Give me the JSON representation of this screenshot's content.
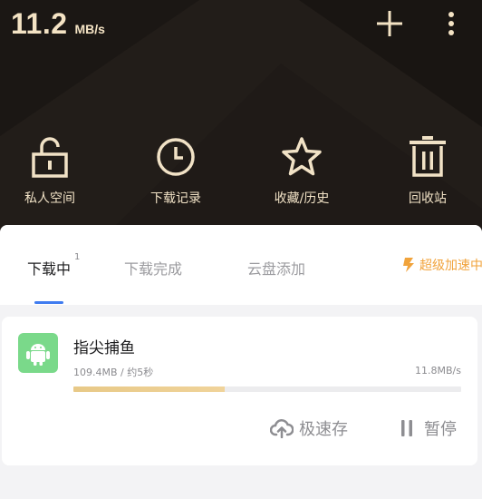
{
  "header": {
    "speed_value": "11.2",
    "speed_unit": "MB/s",
    "add_icon": "plus-icon",
    "more_icon": "more-vertical-icon"
  },
  "quick_actions": [
    {
      "label": "私人空间",
      "icon": "unlock-icon"
    },
    {
      "label": "下载记录",
      "icon": "clock-icon"
    },
    {
      "label": "收藏/历史",
      "icon": "star-icon"
    },
    {
      "label": "回收站",
      "icon": "trash-icon"
    }
  ],
  "tabs": [
    {
      "label": "下载中",
      "badge": "1",
      "active": true
    },
    {
      "label": "下载完成",
      "active": false
    },
    {
      "label": "云盘添加",
      "active": false
    }
  ],
  "boost": {
    "label": "超级加速中",
    "icon": "lightning-icon"
  },
  "download": {
    "name": "指尖捕鱼",
    "meta": "109.4MB / 约5秒",
    "speed": "11.8MB/s",
    "progress": 0.39,
    "icon": "android-icon",
    "actions": {
      "save_label": "极速存",
      "pause_label": "暂停"
    }
  },
  "colors": {
    "header_bg": "#1b1714",
    "gold": "#f1e2c6",
    "accent_blue": "#3f7cf0",
    "boost_orange": "#f1a33b",
    "progress_gold": "#e8c987",
    "android_green": "#7ad98a"
  }
}
